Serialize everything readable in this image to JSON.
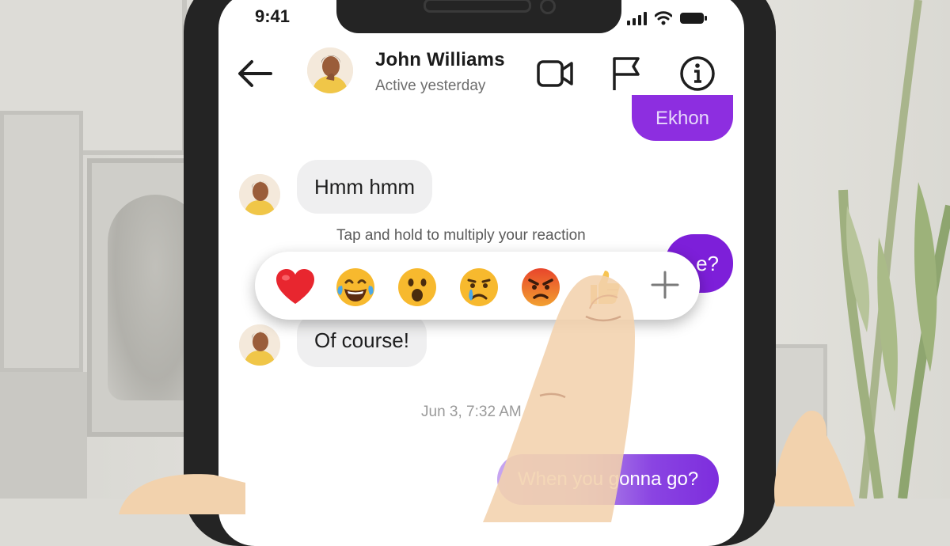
{
  "status_bar": {
    "time": "9:41",
    "icons": [
      "signal-icon",
      "wifi-icon",
      "battery-icon"
    ]
  },
  "header": {
    "contact_name": "John Williams",
    "contact_status": "Active yesterday",
    "icons": [
      "back-arrow-icon",
      "video-call-icon",
      "flag-icon",
      "info-icon"
    ]
  },
  "messages": {
    "outgoing_top_partial": "Ekhon",
    "incoming_1": "Hmm hmm",
    "outgoing_mid_partial": "e?",
    "incoming_2": "Of course!",
    "timestamp": "Jun 3, 7:32 AM",
    "outgoing_bottom": "When you gonna go?"
  },
  "reactions": {
    "hint": "Tap and hold to multiply your reaction",
    "emojis": [
      "heart",
      "tears-of-joy",
      "surprised",
      "crying",
      "angry",
      "thumbs-up"
    ],
    "more_icon": "plus-icon"
  },
  "colors": {
    "outgoing_bubble": "#7d1fd9",
    "incoming_bubble": "#efeff0",
    "phone_bezel": "#242424"
  }
}
